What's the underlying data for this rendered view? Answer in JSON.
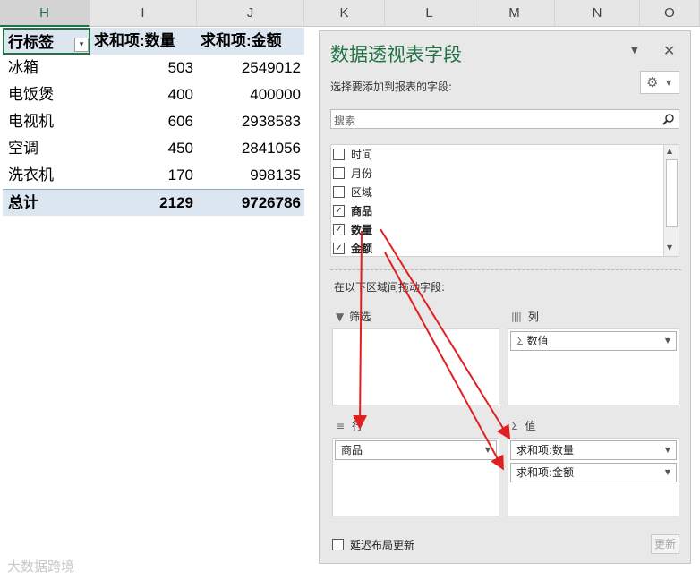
{
  "columns": [
    "H",
    "I",
    "J",
    "K",
    "L",
    "M",
    "N",
    "O"
  ],
  "pivot": {
    "header": {
      "row_label": "行标签",
      "sum_qty": "求和项:数量",
      "sum_amount": "求和项:金额"
    },
    "rows": [
      {
        "item": "冰箱",
        "qty": "503",
        "amount": "2549012"
      },
      {
        "item": "电饭煲",
        "qty": "400",
        "amount": "400000"
      },
      {
        "item": "电视机",
        "qty": "606",
        "amount": "2938583"
      },
      {
        "item": "空调",
        "qty": "450",
        "amount": "2841056"
      },
      {
        "item": "洗衣机",
        "qty": "170",
        "amount": "998135"
      }
    ],
    "total": {
      "label": "总计",
      "qty": "2129",
      "amount": "9726786"
    }
  },
  "pane": {
    "title": "数据透视表字段",
    "choose_label": "选择要添加到报表的字段:",
    "search_placeholder": "搜索",
    "fields": [
      {
        "name": "时间",
        "checked": false
      },
      {
        "name": "月份",
        "checked": false
      },
      {
        "name": "区域",
        "checked": false
      },
      {
        "name": "商品",
        "checked": true
      },
      {
        "name": "数量",
        "checked": true
      },
      {
        "name": "金额",
        "checked": true
      }
    ],
    "drag_label": "在以下区域间拖动字段:",
    "areas": {
      "filter": "筛选",
      "columns": "列",
      "rows": "行",
      "values": "值"
    },
    "column_items": [
      "数值"
    ],
    "row_items": [
      "商品"
    ],
    "value_items": [
      "求和项:数量",
      "求和项:金额"
    ],
    "defer_label": "延迟布局更新",
    "update_label": "更新"
  },
  "watermark": "大数据跨境",
  "accent_color": "#217346",
  "arrow_color": "#e02020",
  "icons": [
    "dropdown-icon",
    "close-icon",
    "gear-icon",
    "search-icon",
    "filter-icon",
    "columns-icon",
    "rows-icon",
    "sigma-icon"
  ]
}
